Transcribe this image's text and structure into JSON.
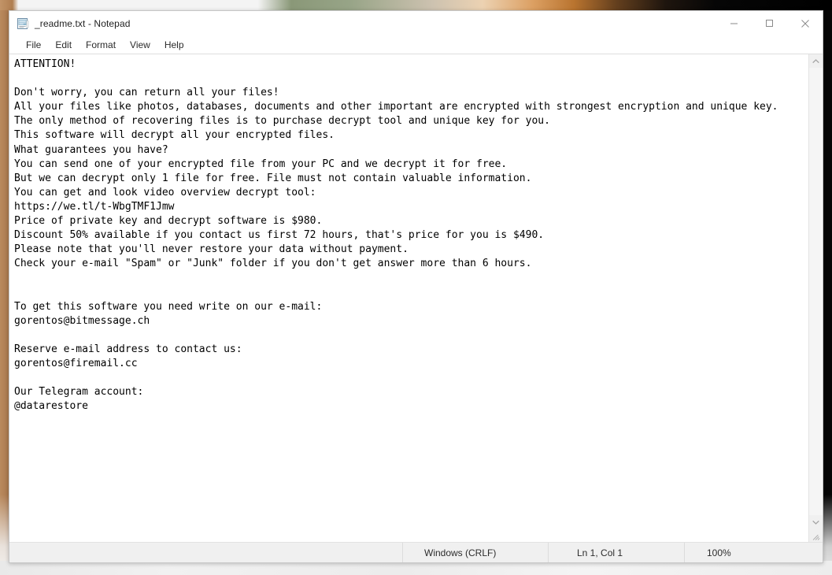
{
  "window": {
    "title": "_readme.txt - Notepad",
    "icon": "notepad-document-icon",
    "controls": {
      "minimize_label": "Minimize",
      "maximize_label": "Maximize",
      "close_label": "Close"
    }
  },
  "menubar": {
    "items": [
      {
        "label": "File"
      },
      {
        "label": "Edit"
      },
      {
        "label": "Format"
      },
      {
        "label": "View"
      },
      {
        "label": "Help"
      }
    ]
  },
  "editor": {
    "content": "ATTENTION!\n\nDon't worry, you can return all your files!\nAll your files like photos, databases, documents and other important are encrypted with strongest encryption and unique key.\nThe only method of recovering files is to purchase decrypt tool and unique key for you.\nThis software will decrypt all your encrypted files.\nWhat guarantees you have?\nYou can send one of your encrypted file from your PC and we decrypt it for free.\nBut we can decrypt only 1 file for free. File must not contain valuable information.\nYou can get and look video overview decrypt tool:\nhttps://we.tl/t-WbgTMF1Jmw\nPrice of private key and decrypt software is $980.\nDiscount 50% available if you contact us first 72 hours, that's price for you is $490.\nPlease note that you'll never restore your data without payment.\nCheck your e-mail \"Spam\" or \"Junk\" folder if you don't get answer more than 6 hours.\n\n\nTo get this software you need write on our e-mail:\ngorentos@bitmessage.ch\n\nReserve e-mail address to contact us:\ngorentos@firemail.cc\n\nOur Telegram account:\n@datarestore",
    "lines": [
      "ATTENTION!",
      "",
      "Don't worry, you can return all your files!",
      "All your files like photos, databases, documents and other important are encrypted with strongest encryption and unique key.",
      "The only method of recovering files is to purchase decrypt tool and unique key for you.",
      "This software will decrypt all your encrypted files.",
      "What guarantees you have?",
      "You can send one of your encrypted file from your PC and we decrypt it for free.",
      "But we can decrypt only 1 file for free. File must not contain valuable information.",
      "You can get and look video overview decrypt tool:",
      "https://we.tl/t-WbgTMF1Jmw",
      "Price of private key and decrypt software is $980.",
      "Discount 50% available if you contact us first 72 hours, that's price for you is $490.",
      "Please note that you'll never restore your data without payment.",
      "Check your e-mail \"Spam\" or \"Junk\" folder if you don't get answer more than 6 hours.",
      "",
      "",
      "To get this software you need write on our e-mail:",
      "gorentos@bitmessage.ch",
      "",
      "Reserve e-mail address to contact us:",
      "gorentos@firemail.cc",
      "",
      "Our Telegram account:",
      "@datarestore"
    ]
  },
  "scrollbar": {
    "up_arrow": "chevron-up-icon",
    "down_arrow": "chevron-down-icon",
    "position": "top"
  },
  "statusbar": {
    "left": "",
    "line_ending": "Windows (CRLF)",
    "cursor": "Ln 1, Col 1",
    "zoom": "100%"
  },
  "colors": {
    "window_bg": "#ffffff",
    "chrome_bg": "#f0f0f0",
    "text": "#000000",
    "border": "#c6c6c6",
    "close_hover": "#e81123"
  }
}
